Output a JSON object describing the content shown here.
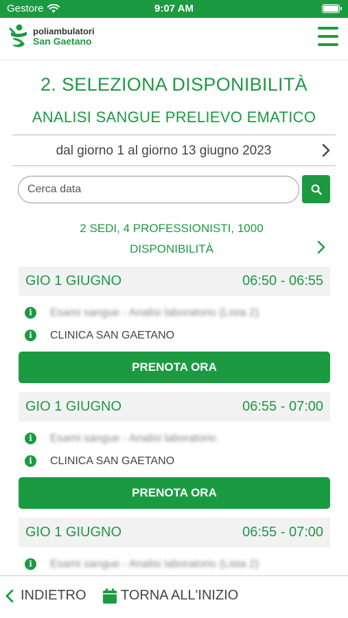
{
  "status_bar": {
    "carrier": "Gestore",
    "time": "9:07 AM"
  },
  "header": {
    "logo_line1": "poliambulatori",
    "logo_line2": "San Gaetano",
    "menu_icon": "hamburger-menu-icon"
  },
  "page": {
    "title": "2. SELEZIONA DISPONIBILITÀ",
    "service": "ANALISI SANGUE PRELIEVO EMATICO",
    "date_range": "dal giorno 1 al giorno 13 giugno 2023"
  },
  "search": {
    "placeholder": "Cerca data",
    "value": ""
  },
  "summary": {
    "line1": "2 SEDI, 4 PROFESSIONISTI, 1000",
    "line2": "DISPONIBILITÀ"
  },
  "slots": [
    {
      "day": "GIO 1 GIUGNO",
      "hours": "06:50 - 06:55",
      "service": "Esami sangue - Analisi laboratorio (Lista 2)",
      "location": "CLINICA SAN GAETANO",
      "button": "PRENOTA ORA"
    },
    {
      "day": "GIO 1 GIUGNO",
      "hours": "06:55 - 07:00",
      "service": "Esami sangue - Analisi laboratorio",
      "location": "CLINICA SAN GAETANO",
      "button": "PRENOTA ORA"
    },
    {
      "day": "GIO 1 GIUGNO",
      "hours": "06:55 - 07:00",
      "service": "Esami sangue - Analisi laboratorio (Lista 2)"
    }
  ],
  "bottom_bar": {
    "back": "INDIETRO",
    "home": "TORNA ALL'INIZIO"
  },
  "colors": {
    "brand_green": "#1b9a42",
    "slot_header_bg": "#f2f2f2"
  }
}
